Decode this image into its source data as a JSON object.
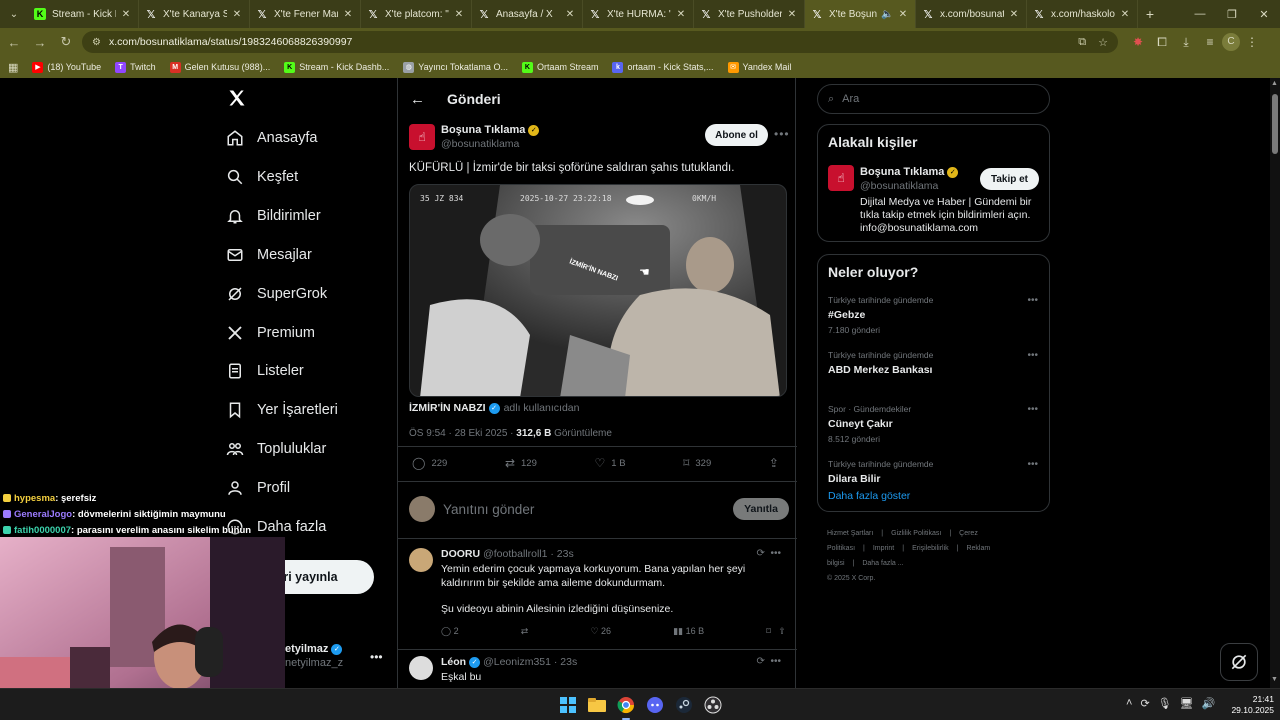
{
  "browser": {
    "tabs": [
      {
        "icon": "kick",
        "title": "Stream - Kick Das"
      },
      {
        "icon": "x",
        "title": "X'te Kanarya Spo"
      },
      {
        "icon": "x",
        "title": "X'te Fener Markaj"
      },
      {
        "icon": "x",
        "title": "X'te platcom: \"Ki"
      },
      {
        "icon": "x",
        "title": "Anasayfa / X"
      },
      {
        "icon": "x",
        "title": "X'te HURMA: \"Bu"
      },
      {
        "icon": "x",
        "title": "X'te Pusholder: \"S"
      },
      {
        "icon": "x",
        "title": "X'te Boşuna T"
      },
      {
        "icon": "x",
        "title": "x.com/bosunatikl"
      },
      {
        "icon": "x",
        "title": "x.com/haskologl"
      }
    ],
    "active_tab": 7,
    "url": "x.com/bosunatiklama/status/1983246068826390997",
    "bookmarks": [
      {
        "icon": "youtube",
        "label": "(18) YouTube",
        "color": "#ff0000"
      },
      {
        "icon": "twitch",
        "label": "Twitch",
        "color": "#9146ff"
      },
      {
        "icon": "mail",
        "label": "Gelen Kutusu (988)...",
        "color": "#d93025"
      },
      {
        "icon": "kick",
        "label": "Stream - Kick Dashb...",
        "color": "#53fc18"
      },
      {
        "icon": "globe",
        "label": "Yayıncı Tokatlama O...",
        "color": "#9aa0a6"
      },
      {
        "icon": "kick",
        "label": "Ortaam Stream",
        "color": "#53fc18"
      },
      {
        "icon": "kickstats",
        "label": "ortaam - Kick Stats,...",
        "color": "#5865f2"
      },
      {
        "icon": "yandex",
        "label": "Yandex Mail",
        "color": "#ff9900"
      }
    ]
  },
  "nav": {
    "items": [
      {
        "icon": "home-icon",
        "label": "Anasayfa"
      },
      {
        "icon": "search-icon",
        "label": "Keşfet"
      },
      {
        "icon": "bell-icon",
        "label": "Bildirimler"
      },
      {
        "icon": "mail-icon",
        "label": "Mesajlar"
      },
      {
        "icon": "grok-icon",
        "label": "SuperGrok"
      },
      {
        "icon": "x-icon",
        "label": "Premium"
      },
      {
        "icon": "list-icon",
        "label": "Listeler"
      },
      {
        "icon": "bookmark-icon",
        "label": "Yer İşaretleri"
      },
      {
        "icon": "community-icon",
        "label": "Topluluklar"
      },
      {
        "icon": "person-icon",
        "label": "Profil"
      },
      {
        "icon": "more-icon",
        "label": "Daha fazla"
      }
    ],
    "post_button": "eri yayınla",
    "account_name": "etyilmaz",
    "account_handle": "netyilmaz_z"
  },
  "main": {
    "header": "Gönderi",
    "tweet": {
      "author": "Boşuna Tıklama",
      "handle": "@bosunatiklama",
      "subscribe": "Abone ol",
      "text": "KÜFÜRLÜ | İzmir'de bir taksi şoförüne saldıran şahıs tutuklandı.",
      "video_overlay_left": "35 JZ 834",
      "video_overlay_time": "2025-10-27 23:22:18",
      "video_overlay_speed": "0KM/H",
      "video_watermark": "İZMİR'İN NABZI",
      "source": "İZMİR'İN NABZI",
      "source_suffix": "adlı kullanıcıdan",
      "time": "ÖS 9:54 · 28 Eki 2025 · ",
      "views": "312,6 B",
      "views_label": "Görüntüleme",
      "replies": "229",
      "reposts": "129",
      "likes": "1 B",
      "bookmarks": "329"
    },
    "reply_placeholder": "Yanıtını gönder",
    "reply_button": "Yanıtla",
    "replies": [
      {
        "name": "DOORU",
        "handle": "@footballroll1 · 23s",
        "text1": "Yemin ederim çocuk yapmaya korkuyorum. Bana yapılan her şeyi kaldırırım bir şekilde ama aileme dokundurmam.",
        "text2": "Şu videoyu abinin Ailesinin izlediğini düşünsenize.",
        "replies": "2",
        "likes": "26",
        "views": "16 B"
      },
      {
        "name": "Léon",
        "handle": "@Leonizm351 · 23s",
        "text1": "Eşkal bu"
      }
    ]
  },
  "sidebar": {
    "search_placeholder": "Ara",
    "relevant_title": "Alakalı kişiler",
    "person": {
      "name": "Boşuna Tıklama",
      "handle": "@bosunatiklama",
      "follow": "Takip et",
      "bio": "Dijital Medya ve Haber | Gündemi bir tıkla takip etmek için bildirimleri açın. info@bosunatiklama.com"
    },
    "trends_title": "Neler oluyor?",
    "trends": [
      {
        "context": "Türkiye tarihinde gündemde",
        "title": "#Gebze",
        "count": "7.180 gönderi"
      },
      {
        "context": "Türkiye tarihinde gündemde",
        "title": "ABD Merkez Bankası",
        "count": ""
      },
      {
        "context": "Spor · Gündemdekiler",
        "title": "Cüneyt Çakır",
        "count": "8.512 gönderi"
      },
      {
        "context": "Türkiye tarihinde gündemde",
        "title": "Dilara Bilir",
        "count": ""
      }
    ],
    "show_more": "Daha fazla göster",
    "footer": [
      "Hizmet Şartları",
      "|",
      "Gizlilik Politikası",
      "|",
      "Çerez Politikası",
      "|",
      "Imprint",
      "|",
      "Erişilebilirlik",
      "|",
      "Reklam bilgisi",
      "|",
      "Daha fazla ...",
      "© 2025 X Corp."
    ]
  },
  "chat": [
    {
      "user": "hypesma",
      "color": "#f4d03f",
      "msg": ": şerefsiz"
    },
    {
      "user": "GeneralJogo",
      "color": "#9b7bff",
      "msg": ": dövmelerini siktiğimin maymunu"
    },
    {
      "user": "fatih0000007",
      "color": "#3cd3ad",
      "msg": ": parasını verelim anasını sikelim bunun"
    }
  ],
  "clock": {
    "time": "21:41",
    "date": "29.10.2025"
  }
}
